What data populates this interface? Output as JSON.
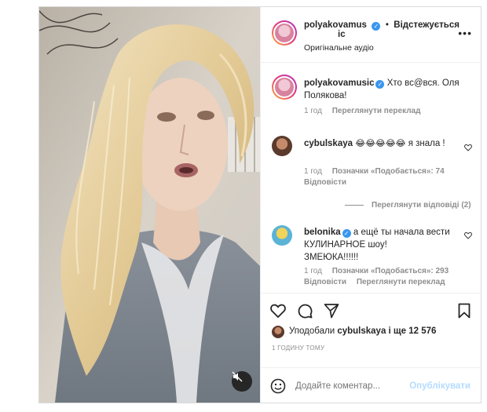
{
  "header": {
    "username_line1": "polyakovamus",
    "username_line2": "ic",
    "separator": "•",
    "follow_label": "Відстежується",
    "audio": "Оригінальне аудіо",
    "more_icon": "more-horizontal-icon"
  },
  "caption": {
    "username": "polyakovamusic",
    "text": "Хто вс@вся. Оля Полякова!",
    "time": "1 год",
    "translate": "Переглянути переклад"
  },
  "comments": [
    {
      "username": "cybulskaya",
      "emoji": "😂😂😂😂😂",
      "text": "я знала !",
      "time": "1 год",
      "likes": "Позначки «Подобається»: 74",
      "reply": "Відповісти",
      "view_replies": "Переглянути відповіді (2)"
    },
    {
      "username": "belonika",
      "text_line1": "а ещё ты начала вести",
      "text_line2": "КУЛИНАРНОЕ шоу!",
      "text_line3": "ЗМЕЮКА!!!!!!",
      "time": "1 год",
      "likes": "Позначки «Подобається»: 293",
      "reply": "Відповісти",
      "translate": "Переглянути переклад"
    }
  ],
  "likes_line": {
    "prefix": "Уподобали",
    "user": "cybulskaya",
    "suffix": "і ще 12 576"
  },
  "time_ago": "1 ГОДИНУ ТОМУ",
  "add_comment": {
    "placeholder": "Додайте коментар...",
    "publish": "Опублікувати"
  },
  "colors": {
    "accent": "#3897f0",
    "publish_disabled": "#b3dbff",
    "muted": "#8e8e8e"
  }
}
